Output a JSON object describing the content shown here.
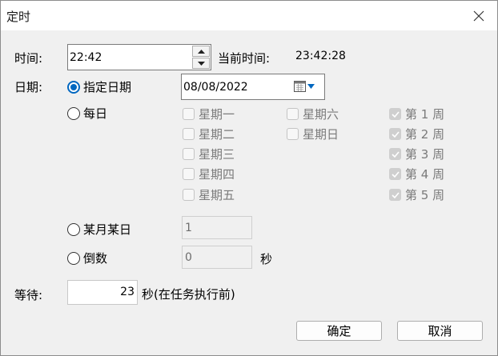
{
  "window": {
    "title": "定时"
  },
  "time": {
    "label": "时间:",
    "value": "22:42",
    "current_label": "当前时间:",
    "current_value": "23:42:28"
  },
  "date": {
    "label": "日期:",
    "specific_label": "指定日期",
    "specific_value": "08/08/2022",
    "daily_label": "每日",
    "weekdays": [
      "星期一",
      "星期二",
      "星期三",
      "星期四",
      "星期五",
      "星期六",
      "星期日"
    ],
    "weeks": [
      "第 1 周",
      "第 2 周",
      "第 3 周",
      "第 4 周",
      "第 5 周"
    ],
    "monthday_label": "某月某日",
    "monthday_value": "1",
    "countdown_label": "倒数",
    "countdown_value": "0",
    "countdown_unit": "秒"
  },
  "wait": {
    "label": "等待:",
    "value": "23",
    "unit_text": "秒(在任务执行前)"
  },
  "buttons": {
    "ok": "确定",
    "cancel": "取消"
  },
  "colors": {
    "accent": "#0067c0",
    "disabled_text": "#7a7a7a"
  }
}
